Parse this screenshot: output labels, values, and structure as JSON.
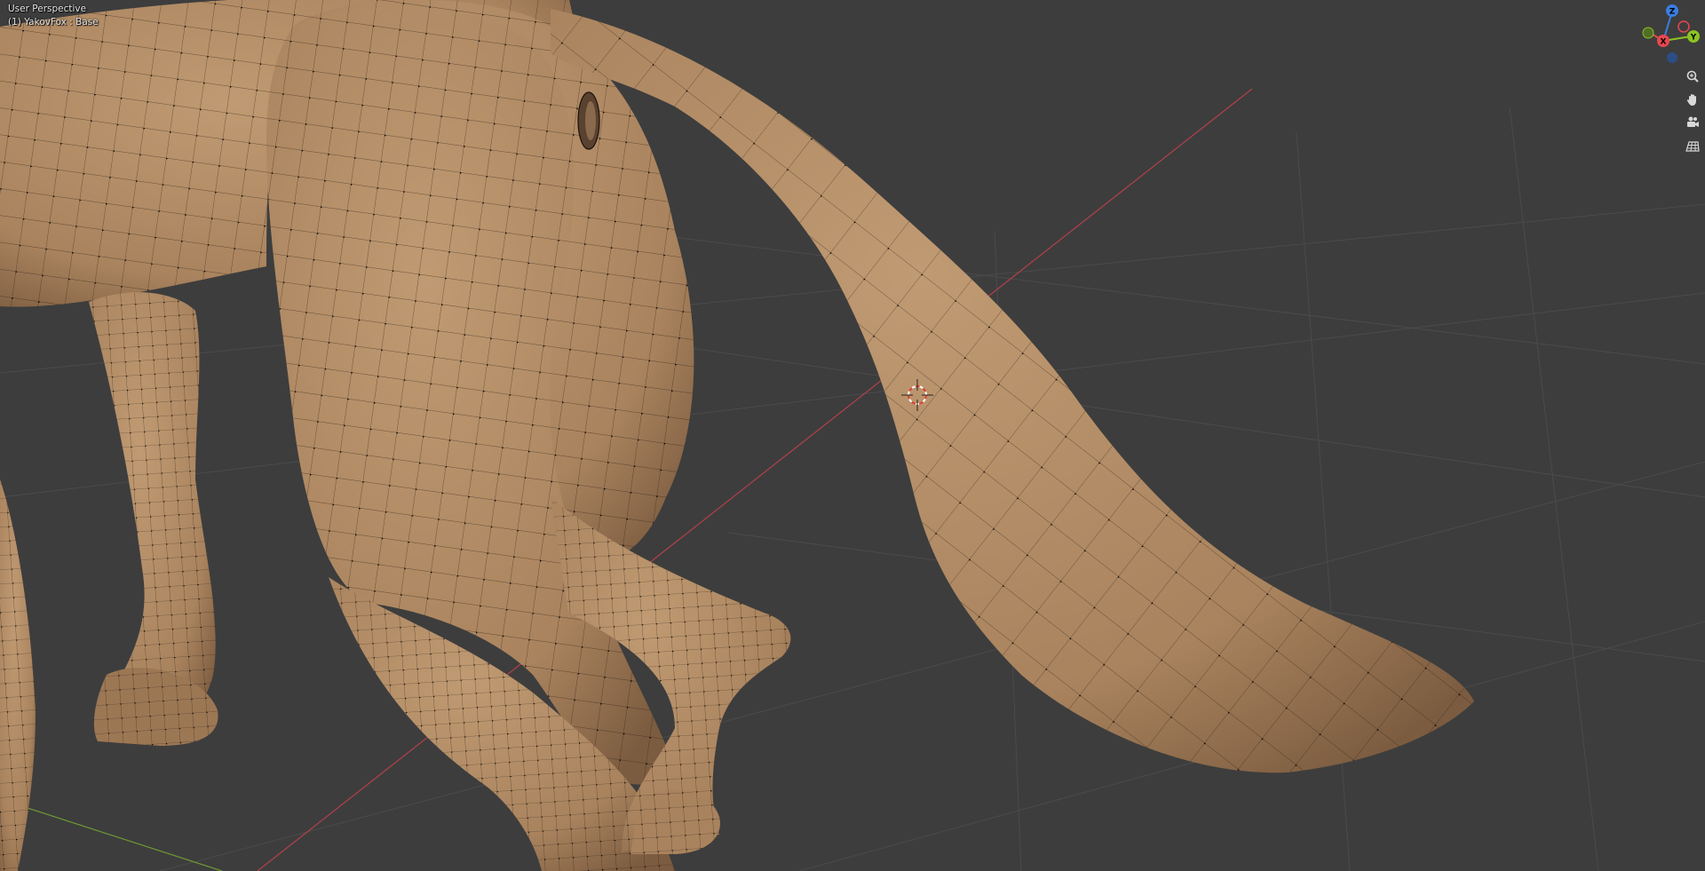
{
  "viewport": {
    "view_name": "User Perspective",
    "object_name": "(1) YakovFox : Base",
    "background": "#3d3d3d",
    "grid_color": "#4a4a4a",
    "x_axis_color": "#b4404c",
    "y_axis_color": "#6c9a34",
    "mesh_color": "#b08760"
  },
  "gizmo": {
    "x_label": "X",
    "y_label": "Y",
    "z_label": "Z",
    "x_color": "#e8474f",
    "y_color": "#8bc322",
    "z_color": "#3a7de0"
  },
  "nav_tools": [
    {
      "name": "zoom-icon"
    },
    {
      "name": "pan-hand-icon"
    },
    {
      "name": "camera-view-icon"
    },
    {
      "name": "ortho-grid-icon"
    }
  ]
}
